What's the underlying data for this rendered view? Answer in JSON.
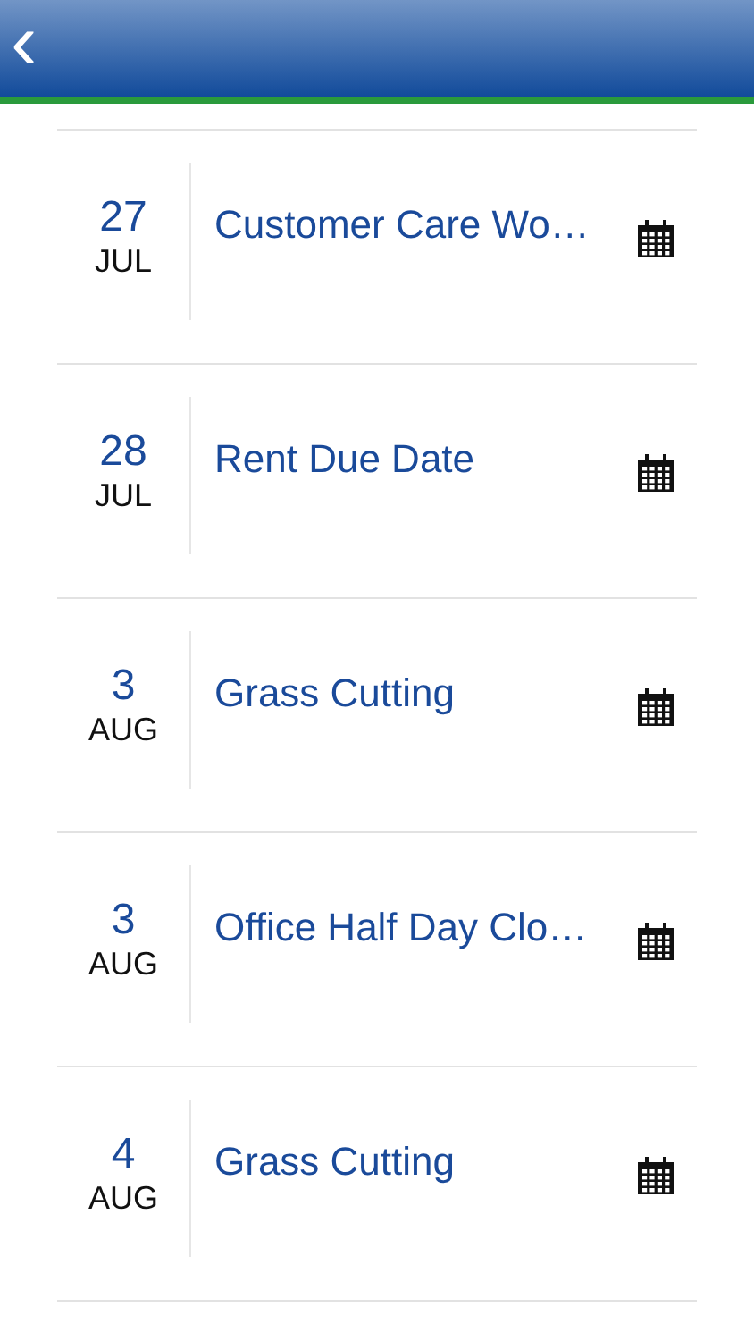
{
  "header": {
    "back": "‹"
  },
  "events": [
    {
      "day": "27",
      "month": "JUL",
      "title": "Customer Care Wo…"
    },
    {
      "day": "28",
      "month": "JUL",
      "title": "Rent Due Date"
    },
    {
      "day": "3",
      "month": "AUG",
      "title": "Grass Cutting"
    },
    {
      "day": "3",
      "month": "AUG",
      "title": "Office Half Day Clo…"
    },
    {
      "day": "4",
      "month": "AUG",
      "title": "Grass Cutting"
    }
  ]
}
